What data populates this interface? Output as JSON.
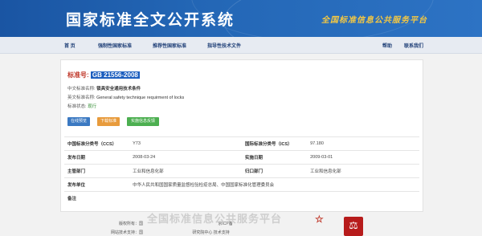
{
  "header": {
    "site_title": "国家标准全文公开系统",
    "slogan": "全国标准信息公共服务平台"
  },
  "nav": {
    "home": "首 页",
    "mandatory": "强制性国家标准",
    "recommended": "推荐性国家标准",
    "guidance": "指导性技术文件",
    "help": "帮助",
    "contact": "联系我们"
  },
  "standard": {
    "no_label": "标准号:",
    "no_value": "GB 21556-2008",
    "cn_name_label": "中文标准名称:",
    "cn_name": "锁具安全通用技术条件",
    "en_name_label": "英文标准名称:",
    "en_name": "General safety technique requirment of locks",
    "status_label": "标准状态:",
    "status": "现行"
  },
  "buttons": {
    "preview": "在线预览",
    "download": "下载标准",
    "feedback": "实施信息反馈"
  },
  "meta": {
    "ccs_label": "中国标准分类号（CCS）",
    "ccs": "Y73",
    "ics_label": "国际标准分类号（ICS）",
    "ics": "97.180",
    "publish_label": "发布日期",
    "publish": "2008-03-24",
    "implement_label": "实施日期",
    "implement": "2009-03-01",
    "dept_label": "主管部门",
    "dept": "工业和信息化部",
    "owner_label": "归口部门",
    "owner": "工业和信息化部",
    "issuer_label": "发布单位",
    "issuer": "中华人民共和国国家质量监督检验检疫总局、中国国家标准化管理委员会",
    "remark_label": "备注",
    "remark": ""
  },
  "footer": {
    "copyright": "版权所有：国",
    "copyright_tail": "京ICP备",
    "support": "网站技术支持：国",
    "support_tail": "研究院中心 技术支持"
  },
  "watermark": "全国标准信息公共服务平台"
}
